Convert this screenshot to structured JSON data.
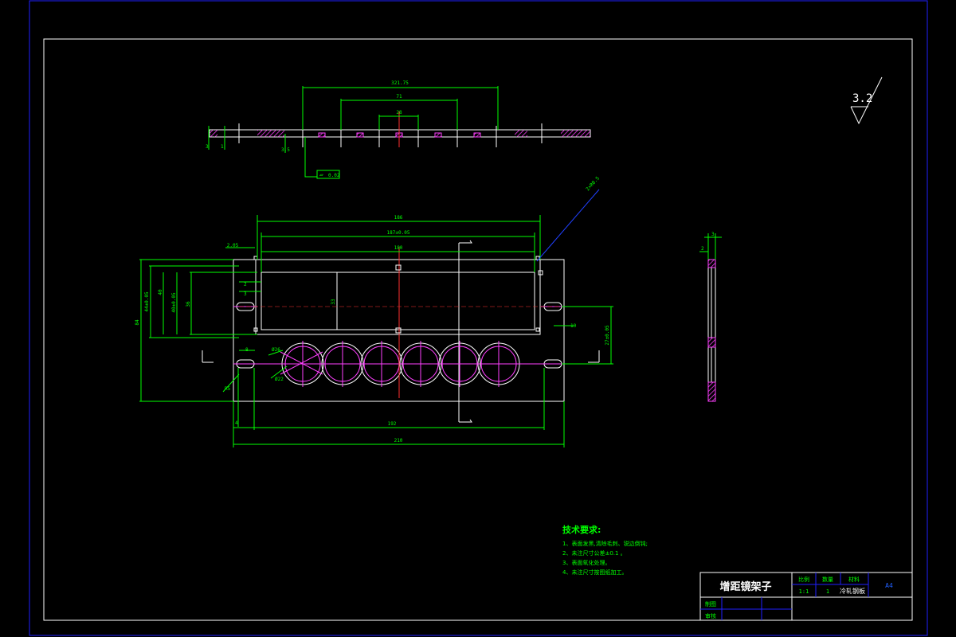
{
  "colors": {
    "background": "#000000",
    "frame": "#ffffff",
    "dimension": "#00ff00",
    "centerline": "#ff3030",
    "hole": "#ff40ff",
    "hatch": "#ff40ff",
    "leader": "#2040ff",
    "note": "#00ff00"
  },
  "section_view": {
    "dims": {
      "overall": "321.75",
      "mid": "71",
      "small": "28",
      "left_h1": "3",
      "left_h2": "1",
      "thick": "3.5"
    },
    "flatness": {
      "symbol": "▱",
      "value": "0.02"
    }
  },
  "plan_view": {
    "dims": {
      "top_overall": "186",
      "top_tol": "187±0.05",
      "top_inner": "180",
      "top_left": "2.05",
      "height_outer": "84",
      "height_tol": "44±0.05",
      "height_2": "40",
      "height_3": "40±0.05",
      "height_4": "36",
      "window_h": "33",
      "small_1": "2",
      "small_2": "3",
      "slot_w": "8",
      "hole_d1": "Ø26",
      "hole_d2": "Ø22",
      "slot_r": "R5",
      "bottom_inner": "192",
      "bottom_overall": "210",
      "bottom_left": "4",
      "right_h": "27±0.05",
      "right_small": "10",
      "leader_note": "2×R0.5"
    }
  },
  "side_view": {
    "dims": {
      "top": "3",
      "left": "2"
    }
  },
  "surface_roughness": "3.2",
  "notes": {
    "title": "技术要求:",
    "items": [
      "1、表面发黑,清除毛刺、锐边倒钝;",
      "2、未注尺寸公差±0.1 。",
      "3、表面氧化处理。",
      "4、未注尺寸按图纸加工。"
    ]
  },
  "title_block": {
    "name": "增距镜架子",
    "h_ratio": "比例",
    "h_qty": "数量",
    "h_material": "材料",
    "ratio": "1:1",
    "qty": "1",
    "material": "冷轧钢板",
    "sheet": "A4",
    "drawn_label": "制图",
    "checked_label": "审核"
  }
}
